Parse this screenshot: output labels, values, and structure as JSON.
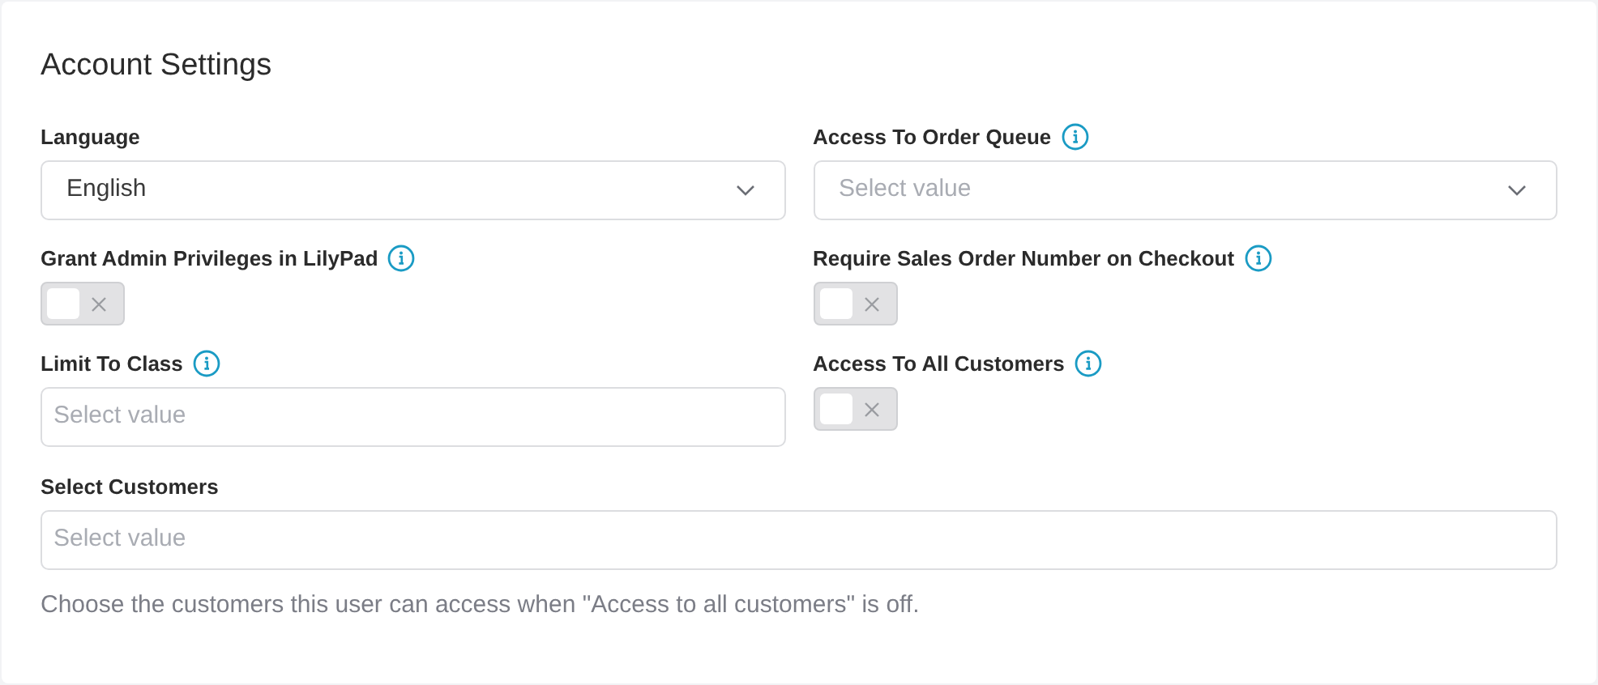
{
  "title": "Account Settings",
  "left_column": [
    {
      "label": "Language",
      "info": false,
      "kind": "select",
      "value": "English"
    },
    {
      "label": "Grant Admin Privileges in LilyPad",
      "info": true,
      "kind": "toggle",
      "on": false
    },
    {
      "label": "Limit To Class",
      "info": true,
      "kind": "input",
      "placeholder": "Select value"
    }
  ],
  "right_column": [
    {
      "label": "Access To Order Queue",
      "info": true,
      "kind": "select",
      "placeholder": "Select value"
    },
    {
      "label": "Require Sales Order Number on Checkout",
      "info": true,
      "kind": "toggle",
      "on": false
    },
    {
      "label": "Access To All Customers",
      "info": true,
      "kind": "toggle",
      "on": false
    }
  ],
  "customers": {
    "label": "Select Customers",
    "info": false,
    "kind": "input",
    "placeholder": "Select value",
    "help": "Choose the customers this user can access when \"Access to all customers\" is off."
  }
}
